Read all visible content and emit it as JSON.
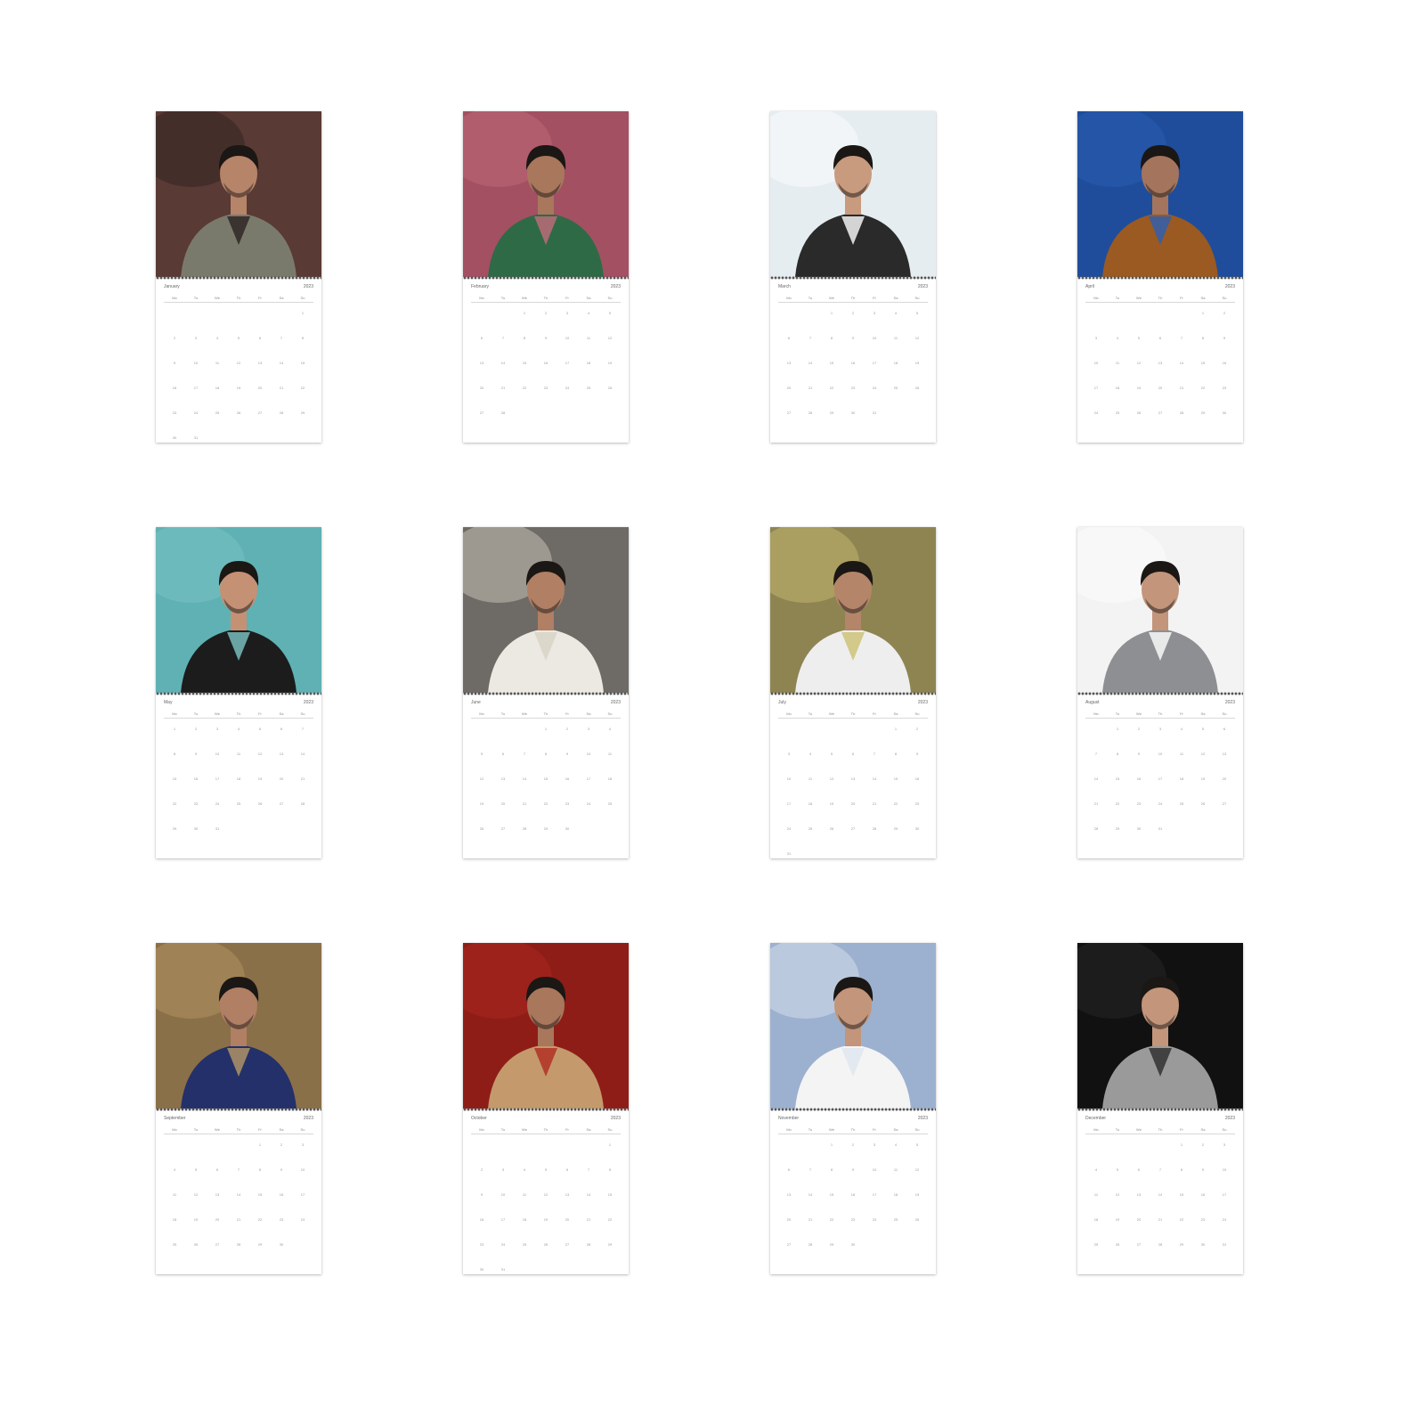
{
  "weekday_labels": [
    "Mo",
    "Tu",
    "We",
    "Th",
    "Fr",
    "Sa",
    "Su"
  ],
  "months": [
    {
      "name": "January",
      "year": "2023",
      "photo": "two-men-grey-suits-dark-red-backdrop",
      "offset": 6,
      "days": 31,
      "colors": {
        "bg": "#5a3a34",
        "accent": "#2b2220",
        "clothes": "#7a7a6c",
        "skin": "#b68468"
      }
    },
    {
      "name": "February",
      "year": "2023",
      "photo": "man-green-suit-pink-backdrop",
      "offset": 2,
      "days": 28,
      "colors": {
        "bg": "#a35063",
        "accent": "#c46c7c",
        "clothes": "#2f6a46",
        "skin": "#a8775c"
      }
    },
    {
      "name": "March",
      "year": "2023",
      "photo": "man-striped-shirt-smoking-white-backdrop",
      "offset": 2,
      "days": 31,
      "colors": {
        "bg": "#e6edf1",
        "accent": "#ffffff",
        "clothes": "#2a2a2a",
        "skin": "#c89a7e"
      }
    },
    {
      "name": "April",
      "year": "2023",
      "photo": "man-brown-suede-jacket-blue-backdrop",
      "offset": 5,
      "days": 30,
      "colors": {
        "bg": "#1f4d9b",
        "accent": "#2b5fb6",
        "clothes": "#9a5a22",
        "skin": "#a4755c"
      }
    },
    {
      "name": "May",
      "year": "2023",
      "photo": "man-black-suit-teal-backdrop",
      "offset": 0,
      "days": 31,
      "colors": {
        "bg": "#5fb1b4",
        "accent": "#7ec6c6",
        "clothes": "#1c1c1c",
        "skin": "#c49174"
      }
    },
    {
      "name": "June",
      "year": "2023",
      "photo": "man-white-shirt-laughing-studio",
      "offset": 3,
      "days": 30,
      "colors": {
        "bg": "#6e6b66",
        "accent": "#d8d2c6",
        "clothes": "#ece9e2",
        "skin": "#b07f64"
      }
    },
    {
      "name": "July",
      "year": "2023",
      "photo": "man-white-tshirt-armchair-window",
      "offset": 5,
      "days": 31,
      "colors": {
        "bg": "#8e8452",
        "accent": "#cbbf70",
        "clothes": "#eeeeee",
        "skin": "#b48568"
      }
    },
    {
      "name": "August",
      "year": "2023",
      "photo": "man-grey-suit-navy-tie-white-backdrop",
      "offset": 1,
      "days": 31,
      "colors": {
        "bg": "#f3f3f3",
        "accent": "#ffffff",
        "clothes": "#8d8f92",
        "skin": "#c3957a"
      }
    },
    {
      "name": "September",
      "year": "2023",
      "photo": "man-blue-velvet-jacket-ornate-room",
      "offset": 4,
      "days": 30,
      "colors": {
        "bg": "#8a7048",
        "accent": "#b89a66",
        "clothes": "#24306a",
        "skin": "#b07f64"
      }
    },
    {
      "name": "October",
      "year": "2023",
      "photo": "man-tan-shirt-red-backdrop",
      "offset": 6,
      "days": 31,
      "colors": {
        "bg": "#8f1d17",
        "accent": "#b02a22",
        "clothes": "#c49a6c",
        "skin": "#a8775c"
      }
    },
    {
      "name": "November",
      "year": "2023",
      "photo": "man-white-outfit-cloudy-sky",
      "offset": 2,
      "days": 30,
      "colors": {
        "bg": "#9cb1cf",
        "accent": "#dfe6f0",
        "clothes": "#f4f4f4",
        "skin": "#c3957a"
      }
    },
    {
      "name": "December",
      "year": "2023",
      "photo": "man-grey-suit-seated-black-backdrop",
      "offset": 4,
      "days": 31,
      "colors": {
        "bg": "#111111",
        "accent": "#2a2a2a",
        "clothes": "#9a9a9a",
        "skin": "#c3957a"
      }
    }
  ]
}
